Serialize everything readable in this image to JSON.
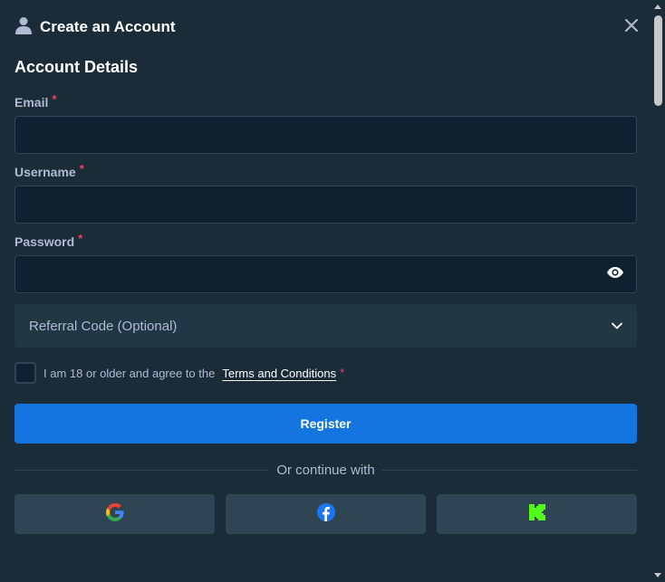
{
  "header": {
    "title": "Create an Account",
    "user_icon": "user-icon",
    "close_icon": "close-icon"
  },
  "section_title": "Account Details",
  "fields": {
    "email": {
      "label": "Email",
      "required_mark": "*",
      "value": ""
    },
    "username": {
      "label": "Username",
      "required_mark": "*",
      "value": ""
    },
    "password": {
      "label": "Password",
      "required_mark": "*",
      "value": "",
      "toggle_icon": "eye-icon"
    }
  },
  "referral": {
    "label": "Referral Code (Optional)",
    "icon": "chevron-down-icon"
  },
  "terms": {
    "text": "I am 18 or older and agree to the",
    "link": "Terms and Conditions",
    "required_mark": "*",
    "checked": false
  },
  "register_label": "Register",
  "divider_text": "Or continue with",
  "social": [
    {
      "name": "google",
      "icon": "google-icon"
    },
    {
      "name": "facebook",
      "icon": "facebook-icon"
    },
    {
      "name": "kick",
      "icon": "kick-icon"
    }
  ],
  "colors": {
    "background": "#1a2c38",
    "input_bg": "#0f212e",
    "border": "#2f4553",
    "accent": "#1475e1",
    "required": "#ed4163",
    "muted_text": "#b1bad3"
  }
}
